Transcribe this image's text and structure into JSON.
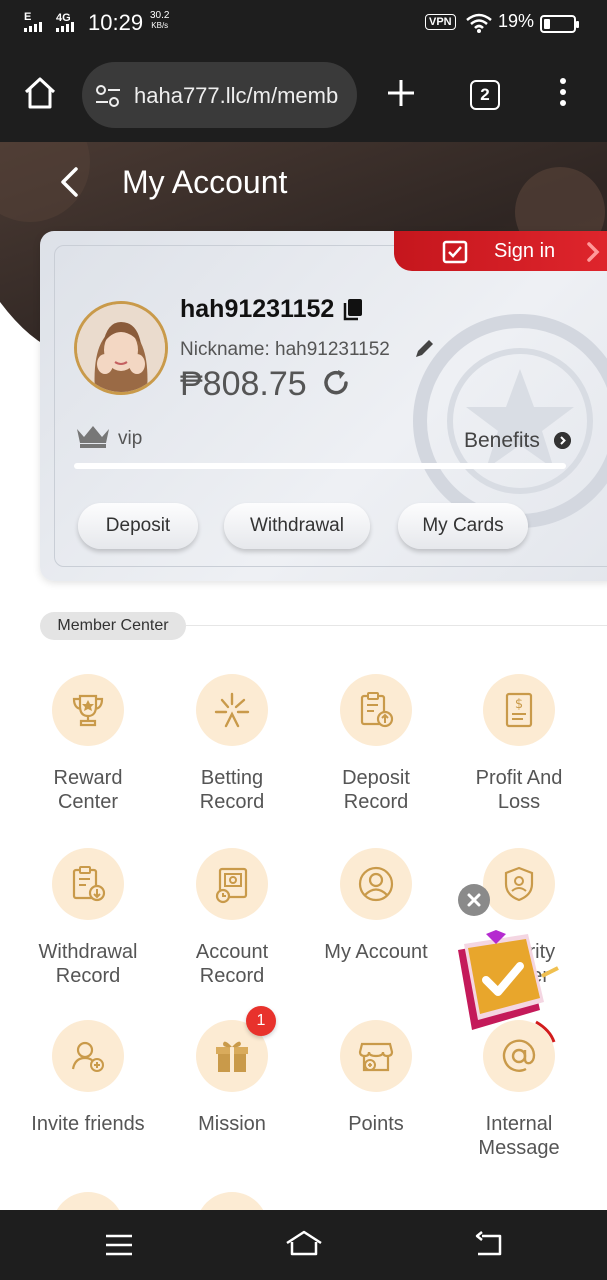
{
  "status_bar": {
    "network": "E",
    "network_type": "4G",
    "time": "10:29",
    "speed_value": "30.2",
    "speed_unit": "KB/s",
    "vpn": "VPN",
    "battery": "19%"
  },
  "browser": {
    "url": "haha777.llc/m/memb",
    "tab_count": "2"
  },
  "header": {
    "title": "My Account"
  },
  "account": {
    "sign_in_label": "Sign in",
    "username": "hah91231152",
    "nickname": "Nickname: hah91231152",
    "balance": "₱808.75",
    "vip_label": "vip",
    "benefits_label": "Benefits",
    "vip_progress": 0,
    "actions": {
      "deposit": "Deposit",
      "withdrawal": "Withdrawal",
      "my_cards": "My Cards"
    }
  },
  "member_center": {
    "title": "Member Center",
    "items": [
      {
        "label": "Reward Center",
        "icon": "trophy-icon"
      },
      {
        "label": "Betting Record",
        "icon": "betting-icon"
      },
      {
        "label": "Deposit Record",
        "icon": "deposit-record-icon"
      },
      {
        "label": "Profit And Loss",
        "icon": "profit-loss-icon"
      },
      {
        "label": "Withdrawal Record",
        "icon": "withdrawal-record-icon"
      },
      {
        "label": "Account Record",
        "icon": "account-record-icon"
      },
      {
        "label": "My Account",
        "icon": "user-icon"
      },
      {
        "label": "Security Center",
        "icon": "shield-user-icon"
      },
      {
        "label": "Invite friends",
        "icon": "invite-icon"
      },
      {
        "label": "Mission",
        "icon": "gift-icon",
        "badge": "1"
      },
      {
        "label": "Points",
        "icon": "store-icon"
      },
      {
        "label": "Internal Message",
        "icon": "at-icon"
      }
    ]
  },
  "colors": {
    "accent_red": "#e0262d",
    "icon_gold": "#c99a4a",
    "icon_bg": "#fcebd3"
  }
}
